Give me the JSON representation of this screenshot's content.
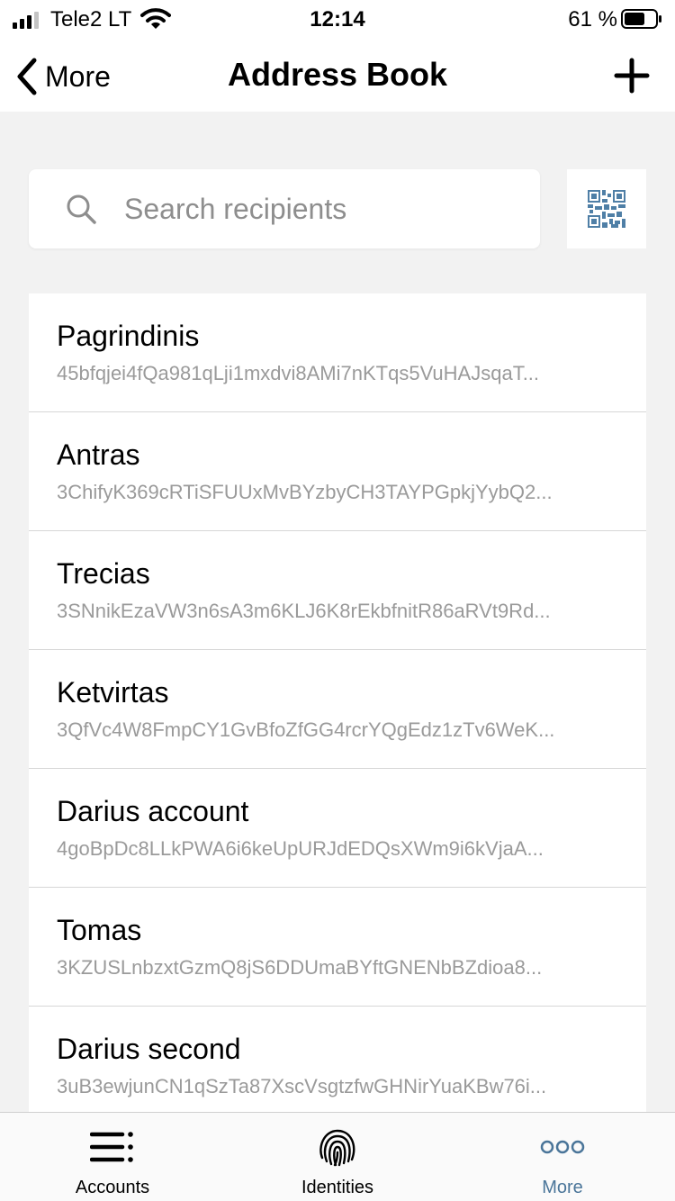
{
  "status_bar": {
    "carrier": "Tele2 LT",
    "time": "12:14",
    "battery": "61 %"
  },
  "nav": {
    "back_label": "More",
    "title": "Address Book"
  },
  "search": {
    "placeholder": "Search recipients"
  },
  "recipients": [
    {
      "name": "Pagrindinis",
      "address": "45bfqjei4fQa981qLji1mxdvi8AMi7nKTqs5VuHAJsqaT..."
    },
    {
      "name": "Antras",
      "address": "3ChifyK369cRTiSFUUxMvBYzbyCH3TAYPGpkjYybQ2..."
    },
    {
      "name": "Trecias",
      "address": "3SNnikEzaVW3n6sA3m6KLJ6K8rEkbfnitR86aRVt9Rd..."
    },
    {
      "name": "Ketvirtas",
      "address": "3QfVc4W8FmpCY1GvBfoZfGG4rcrYQgEdz1zTv6WeK..."
    },
    {
      "name": "Darius account",
      "address": "4goBpDc8LLkPWA6i6keUpURJdEDQsXWm9i6kVjaA..."
    },
    {
      "name": "Tomas",
      "address": "3KZUSLnbzxtGzmQ8jS6DDUmaBYftGNENbBZdioa8..."
    },
    {
      "name": "Darius second",
      "address": "3uB3ewjunCN1qSzTa87XscVsgtzfwGHNirYuaKBw76i..."
    }
  ],
  "tabs": {
    "accounts": "Accounts",
    "identities": "Identities",
    "more": "More"
  },
  "colors": {
    "accent": "#4a7599",
    "qr": "#4f7fa6",
    "secondary_text": "#9a9a9a",
    "background": "#f2f2f2"
  },
  "icons": {
    "signal": "signal-bars-icon",
    "wifi": "wifi-icon",
    "battery": "battery-icon",
    "back": "chevron-left-icon",
    "add": "plus-icon",
    "search": "search-icon",
    "qr": "qr-code-icon",
    "accounts": "list-icon",
    "identities": "fingerprint-icon",
    "more": "more-dots-icon"
  }
}
